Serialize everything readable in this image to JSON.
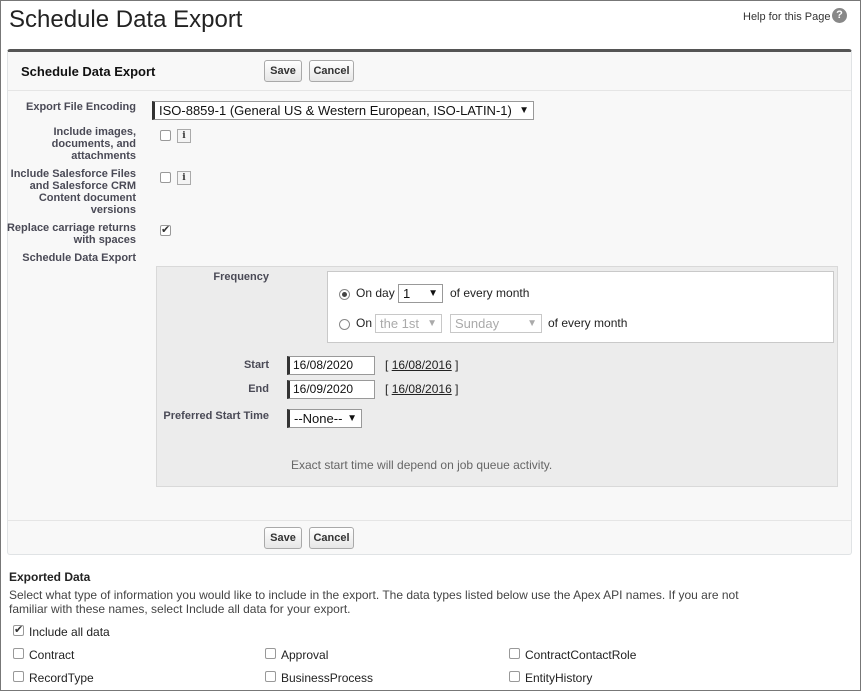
{
  "page": {
    "title": "Schedule Data Export",
    "help_link": "Help for this Page",
    "help_icon": "question-circle-icon"
  },
  "section": {
    "title": "Schedule Data Export",
    "save_label": "Save",
    "cancel_label": "Cancel"
  },
  "fields": {
    "encoding_label": "Export File Encoding",
    "encoding_value": "ISO-8859-1 (General US & Western European, ISO-LATIN-1)",
    "images_label": "Include images, documents, and attachments",
    "images_checked": false,
    "files_label": "Include Salesforce Files and Salesforce CRM Content document versions",
    "files_checked": false,
    "replace_label": "Replace carriage returns with spaces",
    "replace_checked": true,
    "schedule_label": "Schedule Data Export",
    "info_glyph": "i"
  },
  "schedule": {
    "frequency_label": "Frequency",
    "option1_prefix": "On day",
    "option1_day": "1",
    "option1_suffix": "of every month",
    "option1_selected": true,
    "option2_prefix": "On",
    "option2_ordinal": "the 1st",
    "option2_weekday": "Sunday",
    "option2_suffix": "of every month",
    "start_label": "Start",
    "start_value": "16/08/2020",
    "start_today": "16/08/2016",
    "end_label": "End",
    "end_value": "16/09/2020",
    "end_today": "16/08/2016",
    "bracket_open": "[",
    "bracket_close": "]",
    "preferred_label": "Preferred Start Time",
    "preferred_value": "--None--",
    "note": "Exact start time will depend on job queue activity."
  },
  "exported": {
    "title": "Exported Data",
    "description": "Select what type of information you would like to include in the export. The data types listed below use the Apex API names. If you are not familiar with these names, select Include all data for your export.",
    "include_all_label": "Include all data",
    "include_all_checked": true,
    "options": [
      {
        "label": "Contract",
        "checked": false
      },
      {
        "label": "Approval",
        "checked": false
      },
      {
        "label": "ContractContactRole",
        "checked": false
      },
      {
        "label": "RecordType",
        "checked": false
      },
      {
        "label": "BusinessProcess",
        "checked": false
      },
      {
        "label": "EntityHistory",
        "checked": false
      }
    ]
  }
}
